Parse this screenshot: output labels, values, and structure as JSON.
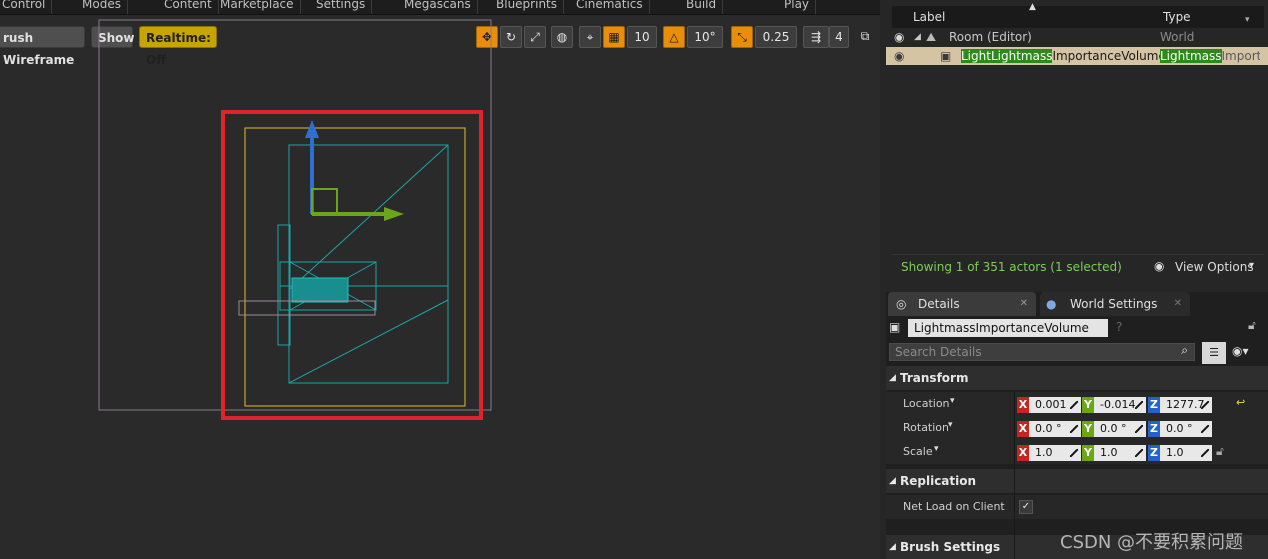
{
  "top_menu": [
    "Control",
    "Modes",
    "Content",
    "Marketplace",
    "Settings",
    "Megascans",
    "Blueprints",
    "Cinematics",
    "Build",
    "Play"
  ],
  "viewport": {
    "wireframe_label": "rush Wireframe",
    "show_label": "Show",
    "realtime_label": "Realtime: Off",
    "grid_snap": "10",
    "rotation_snap": "10°",
    "scale_snap": "0.25",
    "camera_speed": "4"
  },
  "outliner": {
    "col_label": "Label",
    "col_type": "Type",
    "rows": [
      {
        "label": "Room (Editor)",
        "type": "World"
      },
      {
        "label_hl": "LightLightmass",
        "label_rest": "ImportanceVolume",
        "type_hl": "Lightmass",
        "type_rest": "Importa"
      }
    ],
    "status": "Showing 1 of 351 actors (1 selected)",
    "view_options": "View Options"
  },
  "details": {
    "tab_details": "Details",
    "tab_world": "World Settings",
    "actor_name": "LightmassImportanceVolume",
    "search_placeholder": "Search Details",
    "transform": {
      "title": "Transform",
      "location": {
        "label": "Location",
        "x": "0.001",
        "y": "-0.014",
        "z": "1277.7"
      },
      "rotation": {
        "label": "Rotation",
        "x": "0.0 °",
        "y": "0.0 °",
        "z": "0.0 °"
      },
      "scale": {
        "label": "Scale",
        "x": "1.0",
        "y": "1.0",
        "z": "1.0"
      }
    },
    "replication": {
      "title": "Replication",
      "net_load_label": "Net Load on Client"
    },
    "brush_settings": {
      "title": "Brush Settings"
    }
  },
  "axes": {
    "x": "X",
    "y": "Y",
    "z": "Z"
  },
  "watermark": "CSDN @不要积累问题",
  "colors": {
    "accent_orange": "#e88e0a",
    "selection_red": "#e0242b",
    "highlight_green": "#2d8a1a",
    "wire_cyan": "#1aa6a6"
  }
}
